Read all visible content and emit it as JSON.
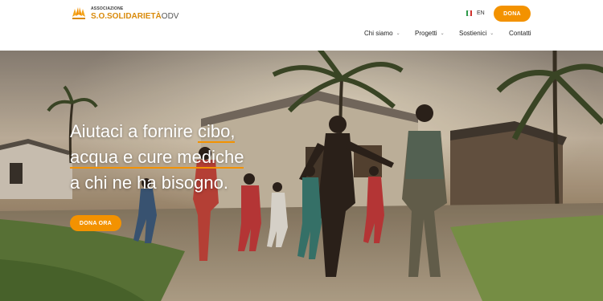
{
  "brand": {
    "association_label": "ASSOCIAZIONE",
    "name": "S.O.SOLIDARIETÀ",
    "suffix": "ODV",
    "accent_color": "#f39200",
    "logo_icon": "hands-heart-logo-icon"
  },
  "header": {
    "language": "EN",
    "language_flag_icon": "italian-flag-icon",
    "donate_label": "DONA"
  },
  "nav": {
    "items": [
      {
        "label": "Chi siamo",
        "has_dropdown": true
      },
      {
        "label": "Progetti",
        "has_dropdown": true
      },
      {
        "label": "Sostienici",
        "has_dropdown": true
      },
      {
        "label": "Contatti",
        "has_dropdown": false
      }
    ],
    "chevron_icon": "chevron-down-icon"
  },
  "hero": {
    "line1_pre": "Aiutaci a fornire ",
    "line1_hl": "cibo,",
    "line2_hl": "acqua e cure mediche",
    "line3": "a chi ne ha bisogno.",
    "cta_label": "DONA ORA",
    "image": "children running on a village dirt road at sunset"
  }
}
